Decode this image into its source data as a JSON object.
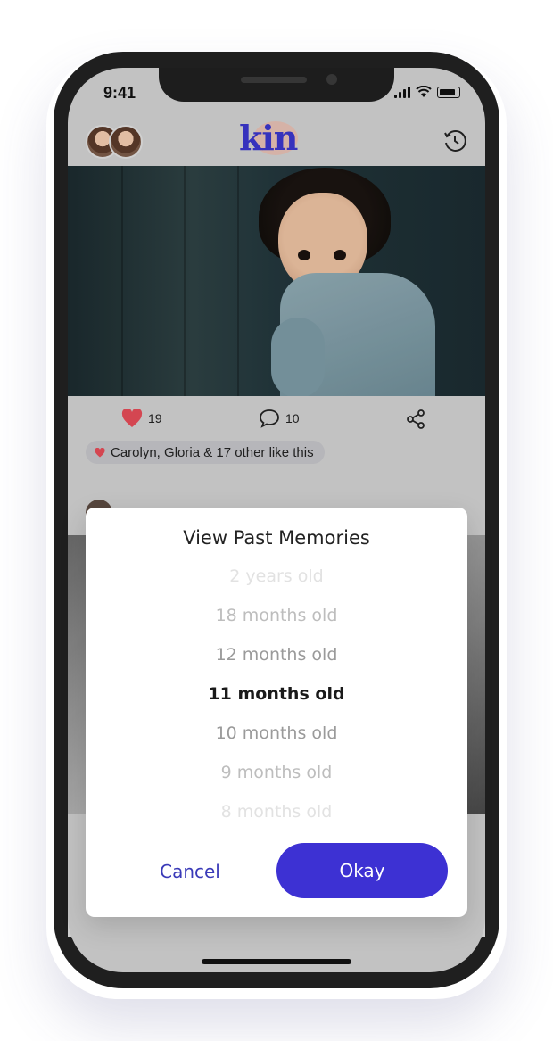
{
  "status_bar": {
    "time": "9:41"
  },
  "header": {
    "logo_text": "kin"
  },
  "post": {
    "likes_count": "19",
    "comments_count": "10",
    "like_summary": "Carolyn, Gloria & 17 other like this"
  },
  "modal": {
    "title": "View Past Memories",
    "options": [
      "2 years old",
      "18 months old",
      "12 months old",
      "11 months old",
      "10 months old",
      "9 months old",
      "8 months old"
    ],
    "selected": "11 months old",
    "cancel_label": "Cancel",
    "okay_label": "Okay"
  },
  "colors": {
    "brand": "#3a36c9",
    "primary_button": "#3d31d3",
    "like_red": "#e24b57"
  },
  "icons": [
    "heart-icon",
    "comment-icon",
    "share-icon",
    "history-icon",
    "wifi-icon",
    "battery-icon",
    "signal-icon"
  ]
}
